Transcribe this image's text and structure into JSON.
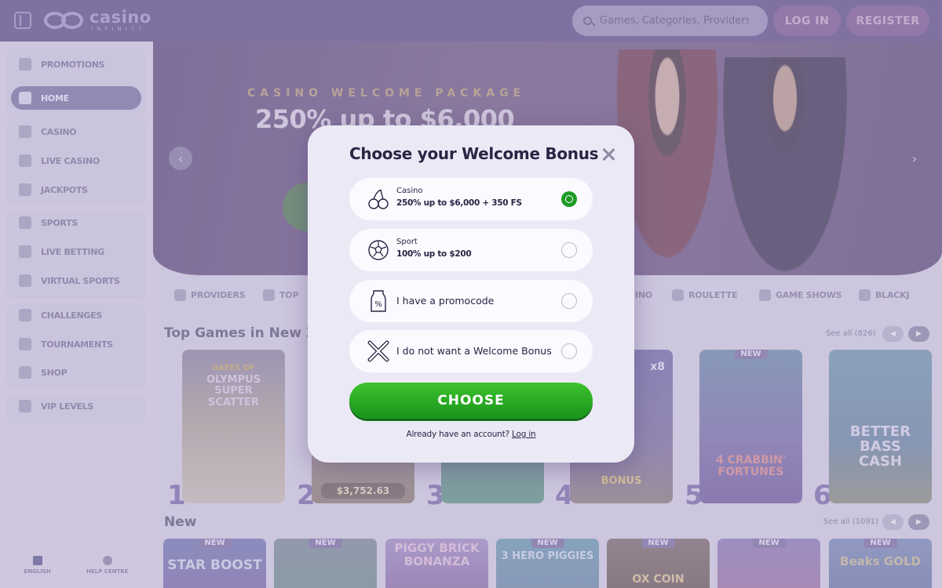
{
  "header": {
    "logo_main": "casino",
    "logo_sub": "INFINITY",
    "search_placeholder": "Games, Categories, Providers",
    "login_label": "LOG IN",
    "register_label": "REGISTER"
  },
  "sidebar": {
    "items": [
      {
        "label": "PROMOTIONS",
        "icon": "gift-icon"
      },
      {
        "label": "HOME",
        "icon": "home-icon",
        "active": true
      },
      {
        "label": "CASINO",
        "icon": "casino-icon"
      },
      {
        "label": "LIVE CASINO",
        "icon": "live-casino-icon"
      },
      {
        "label": "JACKPOTS",
        "icon": "jackpot-icon"
      },
      {
        "label": "SPORTS",
        "icon": "sports-icon"
      },
      {
        "label": "LIVE BETTING",
        "icon": "live-betting-icon"
      },
      {
        "label": "VIRTUAL SPORTS",
        "icon": "virtual-sports-icon"
      },
      {
        "label": "CHALLENGES",
        "icon": "challenges-icon"
      },
      {
        "label": "TOURNAMENTS",
        "icon": "trophy-icon"
      },
      {
        "label": "SHOP",
        "icon": "shop-icon"
      },
      {
        "label": "VIP LEVELS",
        "icon": "star-icon"
      }
    ],
    "footer": {
      "language_label": "ENGLISH",
      "help_label": "HELP CENTRE"
    }
  },
  "hero": {
    "kicker": "CASINO WELCOME PACKAGE",
    "title": "250% up to $6,000",
    "prev_arrow": "‹",
    "next_arrow": "›"
  },
  "categories": [
    "PROVIDERS",
    "TOP",
    "CASINO",
    "ROULETTE",
    "GAME SHOWS",
    "BLACKJ"
  ],
  "rows": {
    "top_title": "Top Games in New Zealand",
    "top_see_all": "See all (826)",
    "new_title": "New",
    "new_see_all": "See all (1091)"
  },
  "top_games": [
    {
      "rank": "1",
      "title": "OLYMPUS SUPER SCATTER",
      "subtitle": "GATES OF"
    },
    {
      "rank": "2",
      "title": "",
      "jackpot": "$3,752.63"
    },
    {
      "rank": "3",
      "title": ""
    },
    {
      "rank": "4",
      "title": "BONUS",
      "badge": "x8"
    },
    {
      "rank": "5",
      "title": "4 CRABBIN' FORTUNES",
      "badge": "NEW"
    },
    {
      "rank": "6",
      "title": "BETTER BASS CASH"
    }
  ],
  "new_games": [
    {
      "title": "STAR BOOST",
      "badge": "NEW"
    },
    {
      "title": "",
      "badge": "NEW"
    },
    {
      "title": "PIGGY BRICK BONANZA",
      "badge": ""
    },
    {
      "title": "3 HERO PIGGIES",
      "badge": "NEW"
    },
    {
      "title": "OX COIN",
      "badge": "NEW"
    },
    {
      "title": "",
      "badge": "NEW"
    },
    {
      "title": "Beaks GOLD",
      "badge": "NEW"
    }
  ],
  "modal": {
    "title": "Choose your Welcome Bonus",
    "options": [
      {
        "kicker": "Casino",
        "main": "250% up to $6,000 + 350 FS",
        "icon": "cherries-icon",
        "selected": true
      },
      {
        "kicker": "Sport",
        "main": "100% up to $200",
        "icon": "soccer-ball-icon",
        "selected": false
      },
      {
        "single": "I have a promocode",
        "icon": "promo-tag-icon",
        "selected": false
      },
      {
        "single": "I do not want a Welcome Bonus",
        "icon": "cross-icon",
        "selected": false
      }
    ],
    "choose_label": "CHOOSE",
    "already_text": "Already have an account?",
    "login_link": "Log in"
  },
  "colors": {
    "accent_green": "#1e9a26",
    "header_purple": "#5f4f86",
    "modal_bg": "#ece9f6"
  }
}
